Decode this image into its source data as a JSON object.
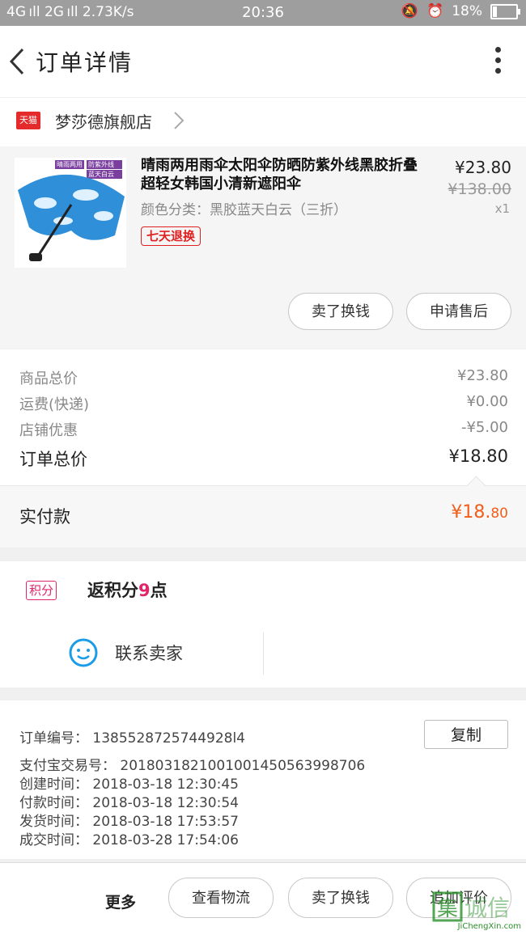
{
  "status_bar": {
    "signal": "4G ıll 2G ıll 2.73K/s",
    "time": "20:36",
    "battery": "18%",
    "battery_level": 0.18
  },
  "header": {
    "title": "订单详情"
  },
  "store": {
    "badge": "天猫",
    "name": "梦莎德旗舰店"
  },
  "product": {
    "image_labels": [
      "晴雨两用",
      "防紫外线",
      "蓝天白云"
    ],
    "title": "晴雨两用雨伞太阳伞防晒防紫外线黑胶折叠超轻女韩国小清新遮阳伞",
    "sku": "颜色分类：黑胶蓝天白云（三折）",
    "tag": "七天退换",
    "price": "¥23.80",
    "original_price": "¥138.00",
    "quantity": "x1",
    "buttons": [
      "卖了换钱",
      "申请售后"
    ]
  },
  "summary": {
    "rows": [
      {
        "label": "商品总价",
        "value": "¥23.80"
      },
      {
        "label": "运费(快递)",
        "value": "¥0.00"
      },
      {
        "label": "店铺优惠",
        "value": "-¥5.00"
      }
    ],
    "total_label": "订单总价",
    "total_value": "¥18.80",
    "paid_label": "实付款",
    "paid_value_main": "¥18.",
    "paid_value_cents": "80"
  },
  "points": {
    "badge": "积分",
    "text_prefix": "返积分",
    "number": "9",
    "text_suffix": "点"
  },
  "contact": {
    "label": "联系卖家"
  },
  "order_info": {
    "order_no": "订单编号：  1385528725744928l4",
    "copy_label": "复制",
    "alipay_no": "支付宝交易号：  2018031821001001450563998706",
    "created": "创建时间：  2018-03-18  12:30:45",
    "paid": "付款时间：  2018-03-18  12:30:54",
    "shipped": "发货时间：  2018-03-18  17:53:57",
    "completed": "成交时间：  2018-03-28  17:54:06"
  },
  "bottom_bar": {
    "more": "更多",
    "buttons": [
      "查看物流",
      "卖了换钱",
      "追加评价"
    ]
  },
  "watermark": {
    "text": "JiChengXin.com",
    "mark": "集诚信"
  },
  "colors": {
    "accent_orange": "#f35d1a",
    "tmall_red": "#e42a2a",
    "points_pink": "#e0266a",
    "status_bar_gray": "#9e9e9e"
  }
}
